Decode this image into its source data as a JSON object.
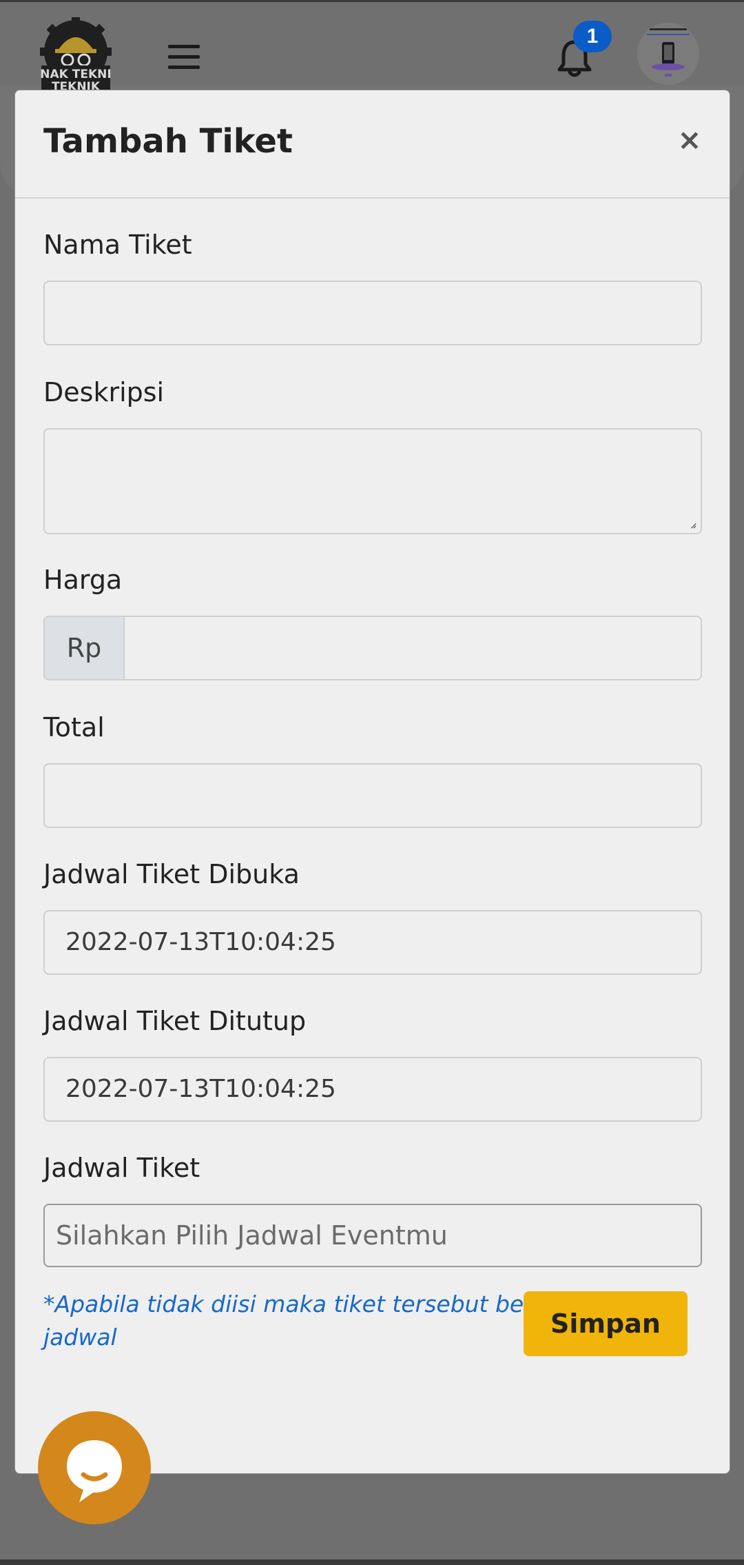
{
  "header": {
    "logo_text": "ANAK TEKNIK",
    "notification_count": "1"
  },
  "modal": {
    "title": "Tambah Tiket",
    "close_symbol": "×"
  },
  "form": {
    "nama_tiket": {
      "label": "Nama Tiket",
      "value": ""
    },
    "deskripsi": {
      "label": "Deskripsi",
      "value": ""
    },
    "harga": {
      "label": "Harga",
      "prefix": "Rp",
      "value": ""
    },
    "total": {
      "label": "Total",
      "value": ""
    },
    "jadwal_dibuka": {
      "label": "Jadwal Tiket Dibuka",
      "value": "2022-07-13T10:04:25"
    },
    "jadwal_ditutup": {
      "label": "Jadwal Tiket Ditutup",
      "value": "2022-07-13T10:04:25"
    },
    "jadwal_tiket": {
      "label": "Jadwal Tiket",
      "placeholder": "Silahkan Pilih Jadwal Eventmu"
    },
    "hint": "*Apabila tidak diisi maka tiket tersebut berisi semua jadwal",
    "save_label": "Simpan"
  },
  "colors": {
    "accent_button": "#f0b40a",
    "hint_text": "#1768c9",
    "badge": "#0b5cc7",
    "chat_fab": "#d4871a"
  },
  "icons": [
    "menu-icon",
    "bell-icon",
    "close-icon",
    "chat-icon"
  ]
}
